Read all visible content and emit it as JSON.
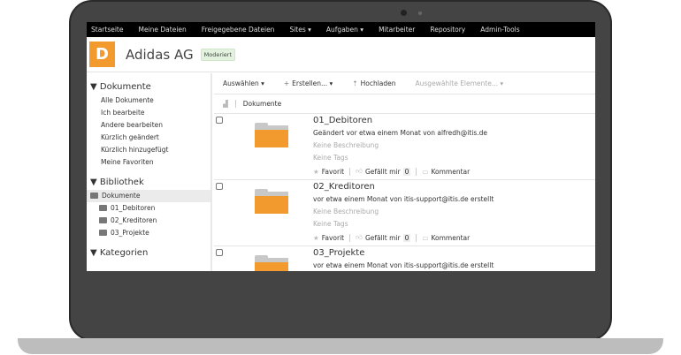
{
  "nav": [
    "Startseite",
    "Meine Dateien",
    "Freigegebene Dateien",
    "Sites ▾",
    "Aufgaben ▾",
    "Mitarbeiter",
    "Repository",
    "Admin-Tools"
  ],
  "site": {
    "logo_letter": "D",
    "title": "Adidas AG",
    "badge": "Moderiert"
  },
  "sidebar": {
    "documents_heading": "▼ Dokumente",
    "documents": [
      "Alle Dokumente",
      "Ich bearbeite",
      "Andere bearbeiten",
      "Kürzlich geändert",
      "Kürzlich hinzugefügt",
      "Meine Favoriten"
    ],
    "library_heading": "▼ Bibliothek",
    "library_root": "Dokumente",
    "library_folders": [
      "01_Debitoren",
      "02_Kreditoren",
      "03_Projekte"
    ],
    "categories_heading": "▼ Kategorien"
  },
  "toolbar": {
    "select": "Auswählen ▾",
    "create": "Erstellen... ▾",
    "upload": "Hochladen",
    "selected": "Ausgewählte Elemente... ▾"
  },
  "list_header": "Dokumente",
  "items": [
    {
      "name": "01_Debitoren",
      "meta": "Geändert vor etwa einem Monat von alfredh@itis.de",
      "desc": "Keine Beschreibung",
      "tags": "Keine Tags",
      "favorite": "Favorit",
      "like": "Gefällt mir",
      "likes": "0",
      "comment": "Kommentar"
    },
    {
      "name": "02_Kreditoren",
      "meta": "vor etwa einem Monat von itis-support@itis.de erstellt",
      "desc": "Keine Beschreibung",
      "tags": "Keine Tags",
      "favorite": "Favorit",
      "like": "Gefällt mir",
      "likes": "0",
      "comment": "Kommentar"
    },
    {
      "name": "03_Projekte",
      "meta": "vor etwa einem Monat von itis-support@itis.de erstellt",
      "desc": "",
      "tags": "",
      "favorite": "",
      "like": "",
      "likes": "",
      "comment": ""
    }
  ],
  "colors": {
    "accent": "#f29a2e",
    "nav_bg": "#000000",
    "badge_bg": "#e3f2df"
  }
}
